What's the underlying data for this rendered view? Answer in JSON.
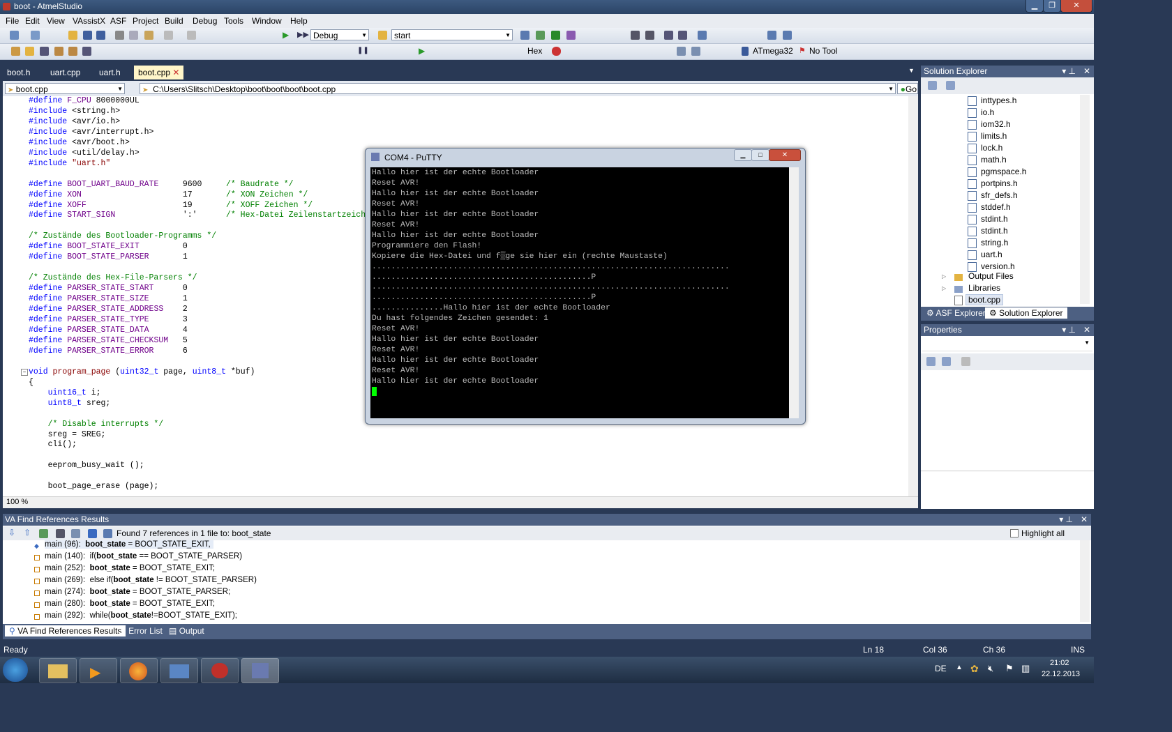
{
  "window": {
    "title": "boot - AtmelStudio"
  },
  "menu": [
    "File",
    "Edit",
    "View",
    "VAssistX",
    "ASF",
    "Project",
    "Build",
    "Debug",
    "Tools",
    "Window",
    "Help"
  ],
  "toolbar": {
    "config": "Debug",
    "start": "start",
    "hex": "Hex",
    "device": "ATmega32",
    "tool": "No Tool"
  },
  "tabs": [
    "boot.h",
    "uart.cpp",
    "uart.h",
    "boot.cpp"
  ],
  "nav": {
    "file": "boot.cpp",
    "path": "C:\\Users\\Slitsch\\Desktop\\boot\\boot\\boot\\boot.cpp",
    "go": "Go"
  },
  "editor": {
    "zoom": "100 %"
  },
  "putty": {
    "title": "COM4 - PuTTY",
    "lines": [
      "Hallo hier ist der echte Bootloader",
      "Reset AVR!",
      "Hallo hier ist der echte Bootloader",
      "Reset AVR!",
      "Hallo hier ist der echte Bootloader",
      "Reset AVR!",
      "Hallo hier ist der echte Bootloader",
      "Programmiere den Flash!",
      "Kopiere die Hex-Datei und f▒ge sie hier ein (rechte Maustaste)",
      "...........................................................................",
      "..............................................P",
      "...........................................................................",
      "..............................................P",
      "...............Hallo hier ist der echte Bootloader",
      "Du hast folgendes Zeichen gesendet: 1",
      "Reset AVR!",
      "Hallo hier ist der echte Bootloader",
      "Reset AVR!",
      "Hallo hier ist der echte Bootloader",
      "Reset AVR!",
      "Hallo hier ist der echte Bootloader"
    ]
  },
  "solution_explorer": {
    "title": "Solution Explorer",
    "items": [
      "inttypes.h",
      "io.h",
      "iom32.h",
      "limits.h",
      "lock.h",
      "math.h",
      "pgmspace.h",
      "portpins.h",
      "sfr_defs.h",
      "stddef.h",
      "stdint.h",
      "stdint.h",
      "string.h",
      "uart.h",
      "version.h"
    ],
    "folders": [
      "Output Files",
      "Libraries"
    ],
    "selected": "boot.cpp",
    "tab_asf": "ASF Explorer",
    "tab_sol": "Solution Explorer"
  },
  "properties": {
    "title": "Properties"
  },
  "find_refs": {
    "title": "VA Find References Results",
    "summary": "Found 7 references in 1 file to: boot_state",
    "highlight_all": "Highlight all",
    "rows": [
      {
        "loc": "main (96):",
        "pre": "",
        "bold": "boot_state",
        "post": " = BOOT_STATE_EXIT,"
      },
      {
        "loc": "main (140):",
        "pre": "if(",
        "bold": "boot_state",
        "post": " == BOOT_STATE_PARSER)"
      },
      {
        "loc": "main (252):",
        "pre": "",
        "bold": "boot_state",
        "post": " = BOOT_STATE_EXIT;"
      },
      {
        "loc": "main (269):",
        "pre": "else if(",
        "bold": "boot_state",
        "post": " != BOOT_STATE_PARSER)"
      },
      {
        "loc": "main (274):",
        "pre": "",
        "bold": "boot_state",
        "post": " = BOOT_STATE_PARSER;"
      },
      {
        "loc": "main (280):",
        "pre": "",
        "bold": "boot_state",
        "post": " = BOOT_STATE_EXIT;"
      },
      {
        "loc": "main (292):",
        "pre": "while(",
        "bold": "boot_state",
        "post": "!=BOOT_STATE_EXIT);"
      }
    ],
    "tabs": [
      "VA Find References Results",
      "Error List",
      "Output"
    ]
  },
  "status": {
    "ready": "Ready",
    "ln": "Ln 18",
    "col": "Col 36",
    "ch": "Ch 36",
    "ins": "INS"
  },
  "tray": {
    "lang": "DE",
    "time": "21:02",
    "date": "22.12.2013"
  }
}
